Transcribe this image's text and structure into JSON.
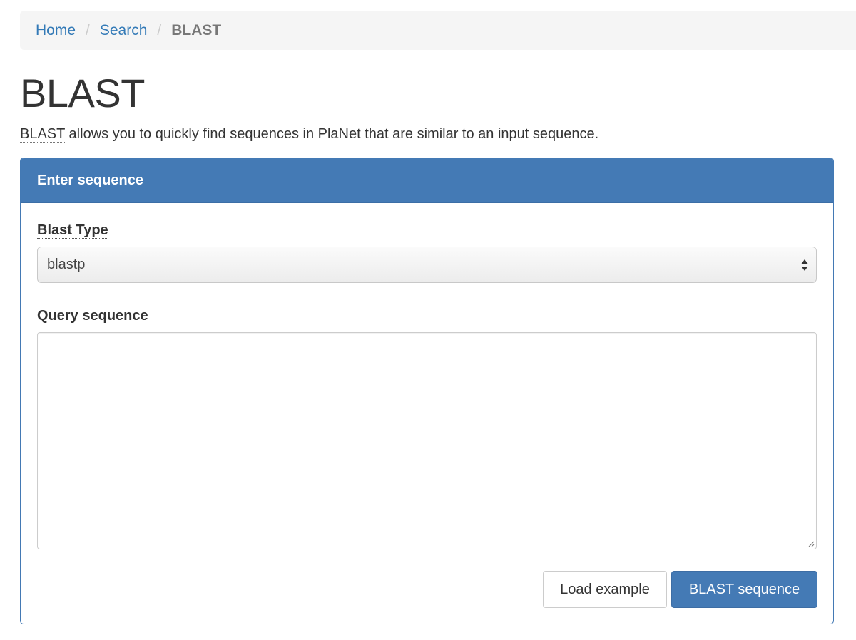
{
  "breadcrumb": {
    "home": "Home",
    "search": "Search",
    "separator": "/",
    "current": "BLAST"
  },
  "page": {
    "title": "BLAST",
    "intro_abbr": "BLAST",
    "intro_text": " allows you to quickly find sequences in PlaNet that are similar to an input sequence."
  },
  "panel": {
    "heading": "Enter sequence",
    "blast_type_label": "Blast Type",
    "blast_type_value": "blastp",
    "query_label": "Query sequence",
    "query_value": "",
    "load_example_label": "Load example",
    "submit_label": "BLAST sequence"
  },
  "colors": {
    "link": "#337ab7",
    "primary": "#447ab5",
    "breadcrumb_bg": "#f5f5f5"
  },
  "icons": {
    "select_arrows": "chevron-up-down-icon",
    "resize_grip": "resize-grip-icon"
  }
}
